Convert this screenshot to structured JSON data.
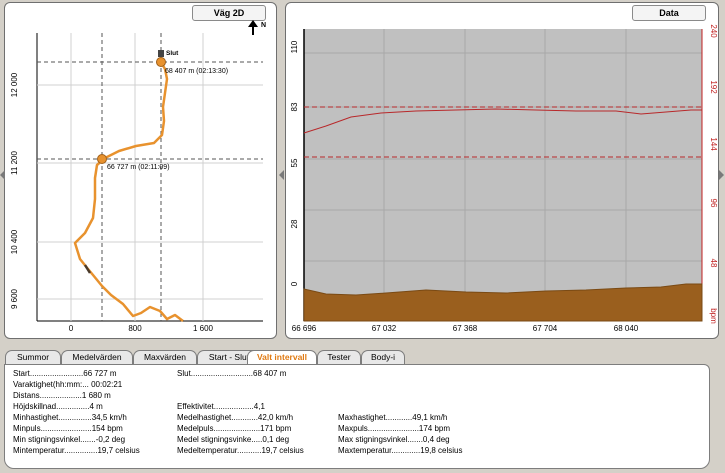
{
  "map": {
    "title": "Väg 2D",
    "north_label": "N",
    "y_ticks": [
      "12 000",
      "11 200",
      "10 400",
      "9 600"
    ],
    "x_ticks": [
      "0",
      "800",
      "1 600"
    ],
    "end_label": "Slut",
    "marker_end_label": "68 407 m (02:13:30)",
    "marker_start_label": "66 727 m (02:11:09)"
  },
  "data_panel": {
    "title": "Data",
    "left_y_ticks": [
      "110",
      "83",
      "55",
      "28",
      "0"
    ],
    "right_y_ticks": [
      "240",
      "192",
      "144",
      "96",
      "48"
    ],
    "right_unit": "bpm",
    "x_ticks": [
      "66 696",
      "67 032",
      "67 368",
      "67 704",
      "68 040"
    ],
    "colors": {
      "plot_bg": "#c0c0c0",
      "altitude": "#9a5f1e",
      "pulse": "#b8282a"
    }
  },
  "tabs": [
    {
      "label": "Summor",
      "active": false
    },
    {
      "label": "Medelvärden",
      "active": false
    },
    {
      "label": "Maxvärden",
      "active": false
    },
    {
      "label": "Start - Slut",
      "active": false
    },
    {
      "label": "Valt intervall",
      "active": true
    },
    {
      "label": "Tester",
      "active": false
    },
    {
      "label": "Body-i",
      "active": false
    }
  ],
  "summary": {
    "start": "Start........................66 727 m",
    "slut": "Slut............................68 407 m",
    "varaktighet": "Varaktighet(hh:mm:...  00:02:21",
    "distans": "Distans...................1 680 m",
    "hojdskillnad": "Höjdskillnad...............4 m",
    "effektivitet": "Effektivitet..................4,1",
    "minhastighet": "Minhastighet...............34,5 km/h",
    "medelhastighet": "Medelhastighet............42,0 km/h",
    "maxhastighet": "Maxhastighet............49,1 km/h",
    "minpuls": "Minpuls.......................154 bpm",
    "medelpuls": "Medelpuls.....................171 bpm",
    "maxpuls": "Maxpuls.......................174 bpm",
    "min_stigning": "Min stigningsvinkel.......-0,2 deg",
    "medel_stigning": "Medel stigningsvinke.....0,1 deg",
    "max_stigning": "Max stigningsvinkel.......0,4 deg",
    "mintemp": "Mintemperatur...............19,7 celsius",
    "medeltemp": "Medeltemperatur...........19,7 celsius",
    "maxtemp": "Maxtemperatur.............19,8 celsius"
  }
}
